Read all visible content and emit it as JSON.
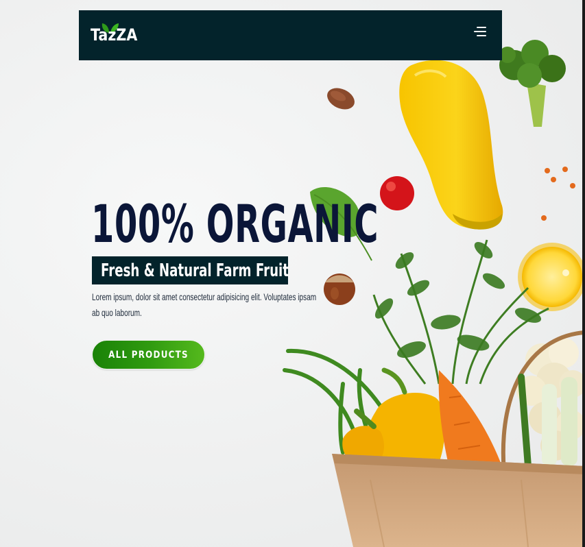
{
  "brand": {
    "name": "TazZA"
  },
  "header": {
    "menu_icon": "hamburger-menu-icon"
  },
  "hero": {
    "headline": "100% ORGANIC",
    "subtitle": "Fresh & Natural Farm Fruit",
    "description": "Lorem ipsum, dolor sit amet consectetur adipisicing elit. Voluptates ipsam ab quo laborum.",
    "cta_label": "ALL PRODUCTS"
  },
  "colors": {
    "header_bg": "#03232b",
    "headline": "#0b1638",
    "cta_start": "#1a8207",
    "cta_end": "#55b91d",
    "leaf": "#2e9a1a"
  }
}
